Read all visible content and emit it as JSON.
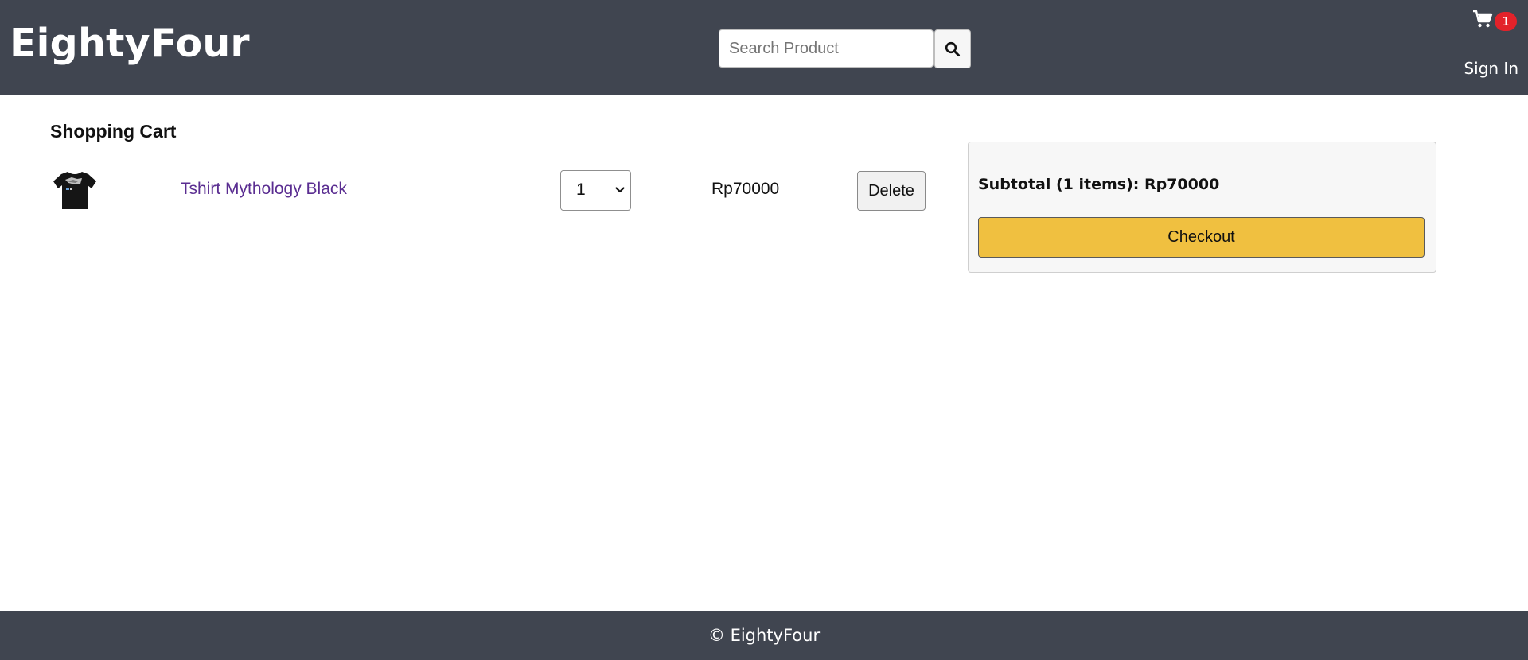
{
  "header": {
    "brand": "EightyFour",
    "search": {
      "placeholder": "Search Product",
      "value": "",
      "button_icon": "search-icon"
    },
    "cart": {
      "icon": "shopping-cart-icon",
      "count": "1"
    },
    "sign_in_label": "Sign In"
  },
  "main": {
    "title": "Shopping Cart",
    "items": [
      {
        "image_icon": "tshirt-product-image",
        "name": "Tshirt Mythology Black",
        "quantity": "1",
        "price": "Rp70000",
        "delete_label": "Delete"
      }
    ],
    "summary": {
      "subtotal": "Subtotal (1 items): Rp70000",
      "checkout_label": "Checkout"
    }
  },
  "footer": {
    "text": "© EightyFour"
  },
  "colors": {
    "header_bg": "#404550",
    "badge": "#e3222a",
    "checkout": "#f0c040",
    "link": "#5a2d91"
  }
}
